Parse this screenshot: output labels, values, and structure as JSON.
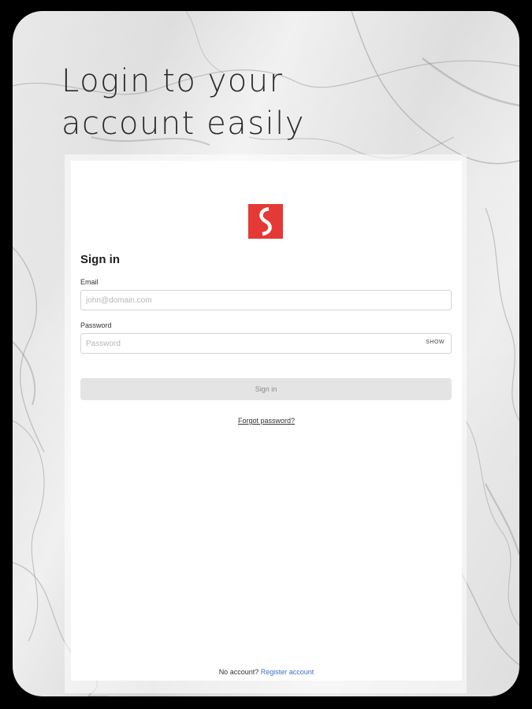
{
  "headline": {
    "line1": "Login to your",
    "line2": "account easily"
  },
  "logo": {
    "icon": "brand-s-logo-icon",
    "color": "#e53935"
  },
  "form": {
    "title": "Sign in",
    "email_label": "Email",
    "email_placeholder": "john@domain.com",
    "email_value": "",
    "password_label": "Password",
    "password_placeholder": "Password",
    "password_value": "",
    "show_label": "SHOW",
    "submit_label": "Sign in",
    "forgot_label": "Forgot password?"
  },
  "footer": {
    "prompt": "No account?",
    "register_label": "Register account",
    "link_color": "#3a6fc4"
  }
}
